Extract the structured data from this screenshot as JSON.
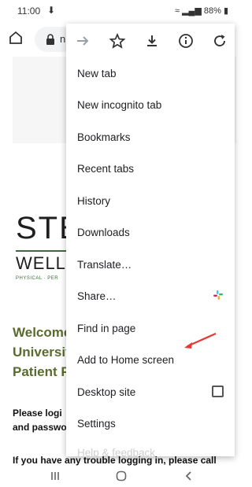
{
  "status_bar": {
    "time": "11:00",
    "battery": "88%"
  },
  "toolbar": {
    "url_partial": "n"
  },
  "page": {
    "logo_big": "STE",
    "logo_sub": "WELL",
    "logo_tag": "PHYSICAL · PER",
    "welcome_lines": [
      "Welcome",
      "Universit",
      "Patient P"
    ],
    "login_lines": [
      "Please logi",
      "and passwo"
    ],
    "trouble_text": "If you have any trouble logging in, please call"
  },
  "menu": {
    "icons": [
      "forward-arrow-icon",
      "star-icon",
      "download-icon",
      "info-icon",
      "refresh-icon"
    ],
    "items": [
      {
        "label": "New tab"
      },
      {
        "label": "New incognito tab"
      },
      {
        "label": "Bookmarks"
      },
      {
        "label": "Recent tabs"
      },
      {
        "label": "History"
      },
      {
        "label": "Downloads"
      },
      {
        "label": "Translate…"
      },
      {
        "label": "Share…"
      },
      {
        "label": "Find in page"
      },
      {
        "label": "Add to Home screen"
      },
      {
        "label": "Desktop site"
      },
      {
        "label": "Settings"
      },
      {
        "label": "Help & feedback"
      }
    ]
  },
  "nav_bar": {
    "icons": [
      "recents-icon",
      "home-circle-icon",
      "back-chevron-icon"
    ]
  },
  "colors": {
    "welcome_green": "#5a6b2e",
    "annotation_red": "#e53935"
  }
}
